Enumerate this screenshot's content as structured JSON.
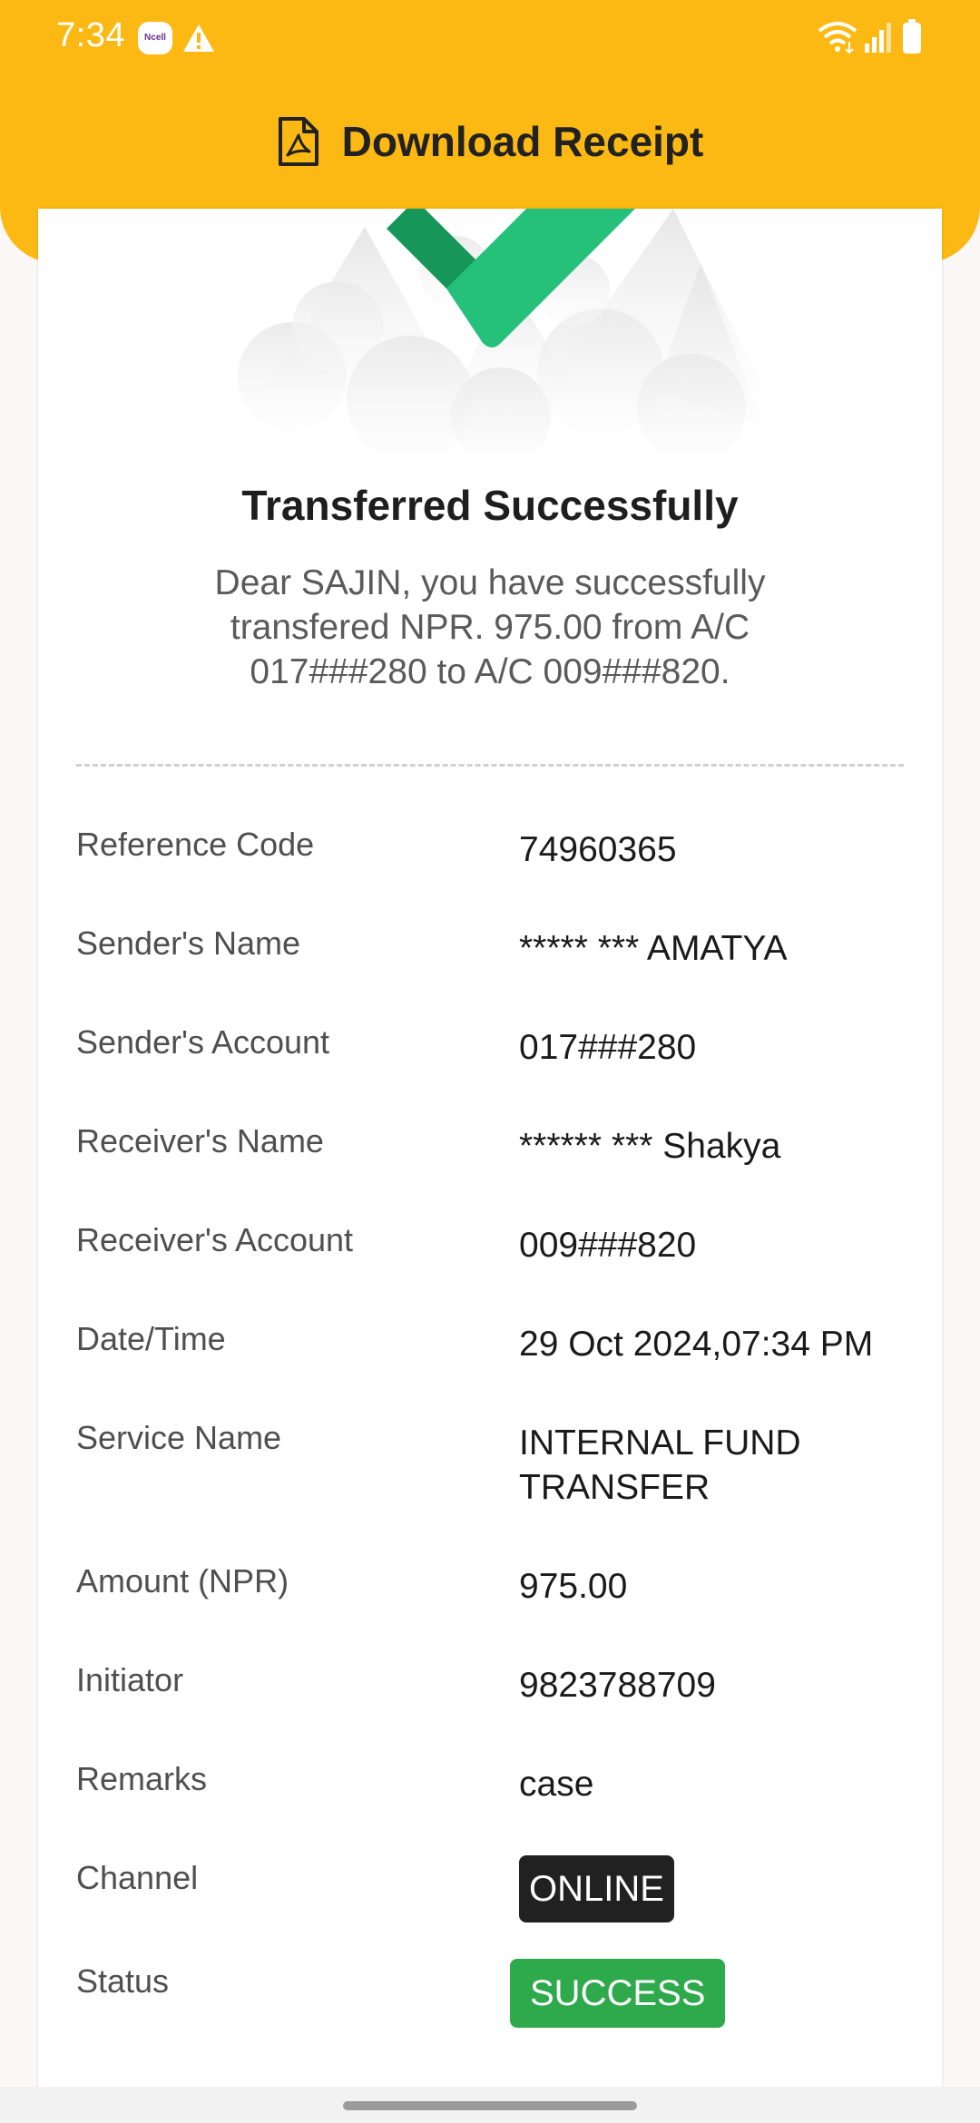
{
  "status_bar": {
    "time": "7:34",
    "carrier_icon": "Ncell",
    "icons": [
      "ncell-icon",
      "warning-icon",
      "wifi-icon",
      "signal-icon",
      "battery-icon"
    ]
  },
  "header": {
    "title": "Download Receipt",
    "icon": "pdf-file-icon",
    "background_color": "#fdb913"
  },
  "receipt": {
    "illustration": "success-checkmark-icon",
    "title": "Transferred Successfully",
    "message": "Dear SAJIN, you have successfully transfered NPR. 975.00 from A/C 017###280 to A/C 009###820.",
    "rows": [
      {
        "label": "Reference Code",
        "value": "74960365"
      },
      {
        "label": "Sender's Name",
        "value": "***** *** AMATYA"
      },
      {
        "label": "Sender's Account",
        "value": "017###280"
      },
      {
        "label": "Receiver's Name",
        "value": "****** *** Shakya"
      },
      {
        "label": "Receiver's Account",
        "value": "009###820"
      },
      {
        "label": "Date/Time",
        "value": "29 Oct 2024,07:34 PM"
      },
      {
        "label": "Service Name",
        "value": "INTERNAL FUND\nTRANSFER"
      },
      {
        "label": "Amount (NPR)",
        "value": "975.00"
      },
      {
        "label": "Initiator",
        "value": "9823788709"
      },
      {
        "label": "Remarks",
        "value": "case"
      }
    ],
    "channel": {
      "label": "Channel",
      "value": "ONLINE"
    },
    "status": {
      "label": "Status",
      "value": "SUCCESS",
      "color": "#2ea94b"
    }
  }
}
